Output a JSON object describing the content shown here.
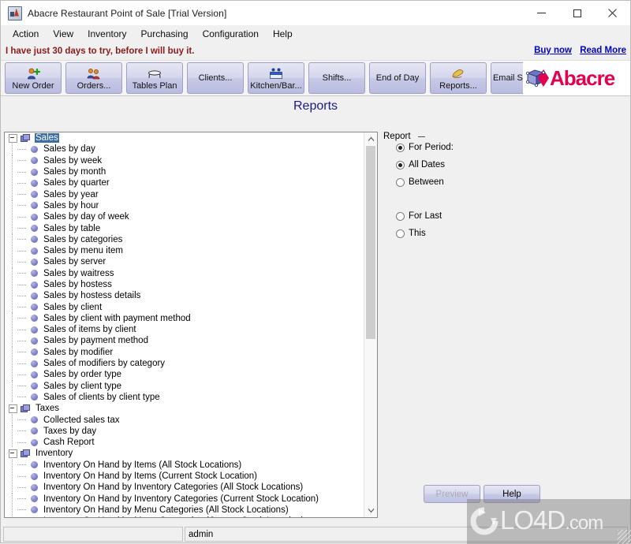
{
  "window": {
    "title": "Abacre Restaurant Point of Sale [Trial Version]",
    "app_icon": "abacre-icon",
    "minimize": "–",
    "maximize": "□",
    "close": "✕"
  },
  "menu": {
    "items": [
      "Action",
      "View",
      "Inventory",
      "Purchasing",
      "Configuration",
      "Help"
    ]
  },
  "trial": {
    "message": "I have just 30 days to try, before I will buy it.",
    "buy_now": "Buy now",
    "read_more": "Read More",
    "text_color": "#8b1a1a",
    "link_color": "#0000c8"
  },
  "toolbar": {
    "buttons": [
      {
        "label": "New Order",
        "icon": "new-order-icon",
        "has_icon": true
      },
      {
        "label": "Orders...",
        "icon": "orders-icon",
        "has_icon": true
      },
      {
        "label": "Tables Plan",
        "icon": "tables-plan-icon",
        "has_icon": true
      },
      {
        "label": "Clients...",
        "icon": "clients-icon",
        "has_icon": false
      },
      {
        "label": "Kitchen/Bar...",
        "icon": "kitchen-bar-icon",
        "has_icon": true
      },
      {
        "label": "Shifts...",
        "icon": "shifts-icon",
        "has_icon": false
      },
      {
        "label": "End of Day",
        "icon": "end-of-day-icon",
        "has_icon": false
      },
      {
        "label": "Reports...",
        "icon": "reports-icon",
        "has_icon": true
      },
      {
        "label": "Email Sender",
        "icon": "email-sender-icon",
        "has_icon": false
      }
    ],
    "logo_text": "Abacre",
    "logo_color": "#e3004f"
  },
  "page": {
    "title": "Reports",
    "title_color": "#1a1a8c"
  },
  "tree": {
    "selected": "Sales",
    "groups": [
      {
        "name": "Sales",
        "icon": "folder-icon",
        "selected": true,
        "items": [
          "Sales by day",
          "Sales by week",
          "Sales by month",
          "Sales by quarter",
          "Sales by year",
          "Sales by hour",
          "Sales by day of week",
          "Sales by table",
          "Sales by categories",
          "Sales by menu item",
          "Sales by server",
          "Sales by waitress",
          "Sales by hostess",
          "Sales by hostess details",
          "Sales by client",
          "Sales by client with payment method",
          "Sales of items by client",
          "Sales by payment method",
          "Sales by modifier",
          "Sales of modifiers by category",
          "Sales by order type",
          "Sales by client type",
          "Sales of clients by client type"
        ]
      },
      {
        "name": "Taxes",
        "icon": "folder-icon",
        "selected": false,
        "items": [
          "Collected sales tax",
          "Taxes by day",
          "Cash Report"
        ]
      },
      {
        "name": "Inventory",
        "icon": "folder-icon",
        "selected": false,
        "items": [
          "Inventory On Hand by Items (All Stock Locations)",
          "Inventory On Hand by Items (Current Stock Location)",
          "Inventory On Hand by Inventory Categories (All Stock Locations)",
          "Inventory On Hand by Inventory Categories (Current Stock Location)",
          "Inventory On Hand by Menu Categories (All Stock Locations)",
          "Inventory On Hand by Menu Categories (Current Stock Location)"
        ]
      }
    ],
    "scrollbar": {
      "up_arrow": "⌃",
      "down_arrow": "⌄"
    }
  },
  "report_panel": {
    "group_label": "Report",
    "options": [
      {
        "label": "For Period:",
        "selected": true,
        "indent": 0
      },
      {
        "label": "All Dates",
        "selected": true,
        "indent": 1
      },
      {
        "label": "Between",
        "selected": false,
        "indent": 1
      },
      {
        "label": "For Last",
        "selected": false,
        "indent": 1
      },
      {
        "label": "This",
        "selected": false,
        "indent": 1
      }
    ],
    "preview_button": "Preview",
    "help_button": "Help"
  },
  "statusbar": {
    "left": "",
    "user": "admin"
  },
  "watermark": {
    "text": "LO4D",
    "suffix": ".com"
  }
}
